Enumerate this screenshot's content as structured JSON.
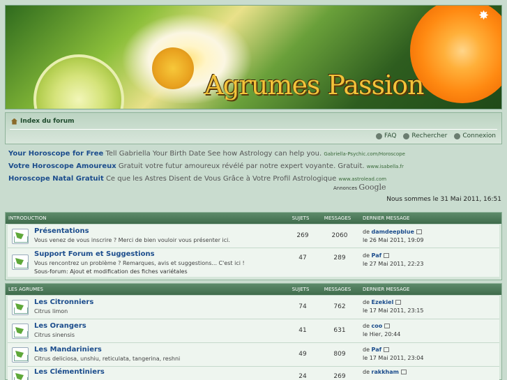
{
  "banner": {
    "title": "Agrumes Passion"
  },
  "nav": {
    "breadcrumb": "Index du forum",
    "links": [
      "FAQ",
      "Rechercher",
      "Connexion"
    ]
  },
  "ads": [
    {
      "title": "Your Horoscope for Free",
      "text": "Tell Gabriella Your Birth Date See how Astrology can help you.",
      "url": "Gabriella-Psychic.com/Horoscope"
    },
    {
      "title": "Votre Horoscope Amoureux",
      "text": "Gratuit votre futur amoureux révélé par notre expert voyante. Gratuit.",
      "url": "www.isabella.fr"
    },
    {
      "title": "Horoscope Natal Gratuit",
      "text": "Ce que les Astres Disent de Vous Grâce à Votre Profil Astrologique",
      "url": "www.astrolead.com"
    }
  ],
  "ads_by": {
    "prefix": "Annonces",
    "brand": "Google"
  },
  "date_line": "Nous sommes le 31 Mai 2011, 16:51",
  "sections": [
    {
      "name": "INTRODUCTION",
      "headers": [
        "SUJETS",
        "MESSAGES",
        "DERNIER MESSAGE"
      ],
      "rows": [
        {
          "title": "Présentations",
          "desc": "Vous venez de vous inscrire ? Merci de bien vouloir vous présenter ici.",
          "sub": "",
          "sujets": "269",
          "messages": "2060",
          "last_by_prefix": "de",
          "last_by": "damdeepblue",
          "last_date": "le 26 Mai 2011, 19:09"
        },
        {
          "title": "Support Forum et Suggestions",
          "desc": "Vous rencontrez un problème ? Remarques, avis et suggestions... C'est ici !",
          "sub": "Sous-forum:  Ajout et modification des fiches variétales",
          "sujets": "47",
          "messages": "289",
          "last_by_prefix": "de",
          "last_by": "Paf",
          "last_date": "le 27 Mai 2011, 22:23"
        }
      ]
    },
    {
      "name": "LES AGRUMES",
      "headers": [
        "SUJETS",
        "MESSAGES",
        "DERNIER MESSAGE"
      ],
      "rows": [
        {
          "title": "Les Citronniers",
          "desc": "Citrus limon",
          "sub": "",
          "sujets": "74",
          "messages": "762",
          "last_by_prefix": "de",
          "last_by": "Ezekiel",
          "last_date": "le 17 Mai 2011, 23:15"
        },
        {
          "title": "Les Orangers",
          "desc": "Citrus sinensis",
          "sub": "",
          "sujets": "41",
          "messages": "631",
          "last_by_prefix": "de",
          "last_by": "coo",
          "last_date": "le Hier, 20:44"
        },
        {
          "title": "Les Mandariniers",
          "desc": "Citrus deliciosa, unshiu, reticulata, tangerina, reshni",
          "sub": "",
          "sujets": "49",
          "messages": "809",
          "last_by_prefix": "de",
          "last_by": "Paf",
          "last_date": "le 17 Mai 2011, 23:04"
        },
        {
          "title": "Les Clémentiniers",
          "desc": "",
          "sub": "",
          "sujets": "24",
          "messages": "269",
          "last_by_prefix": "de",
          "last_by": "rakkham",
          "last_date": ""
        }
      ]
    }
  ]
}
